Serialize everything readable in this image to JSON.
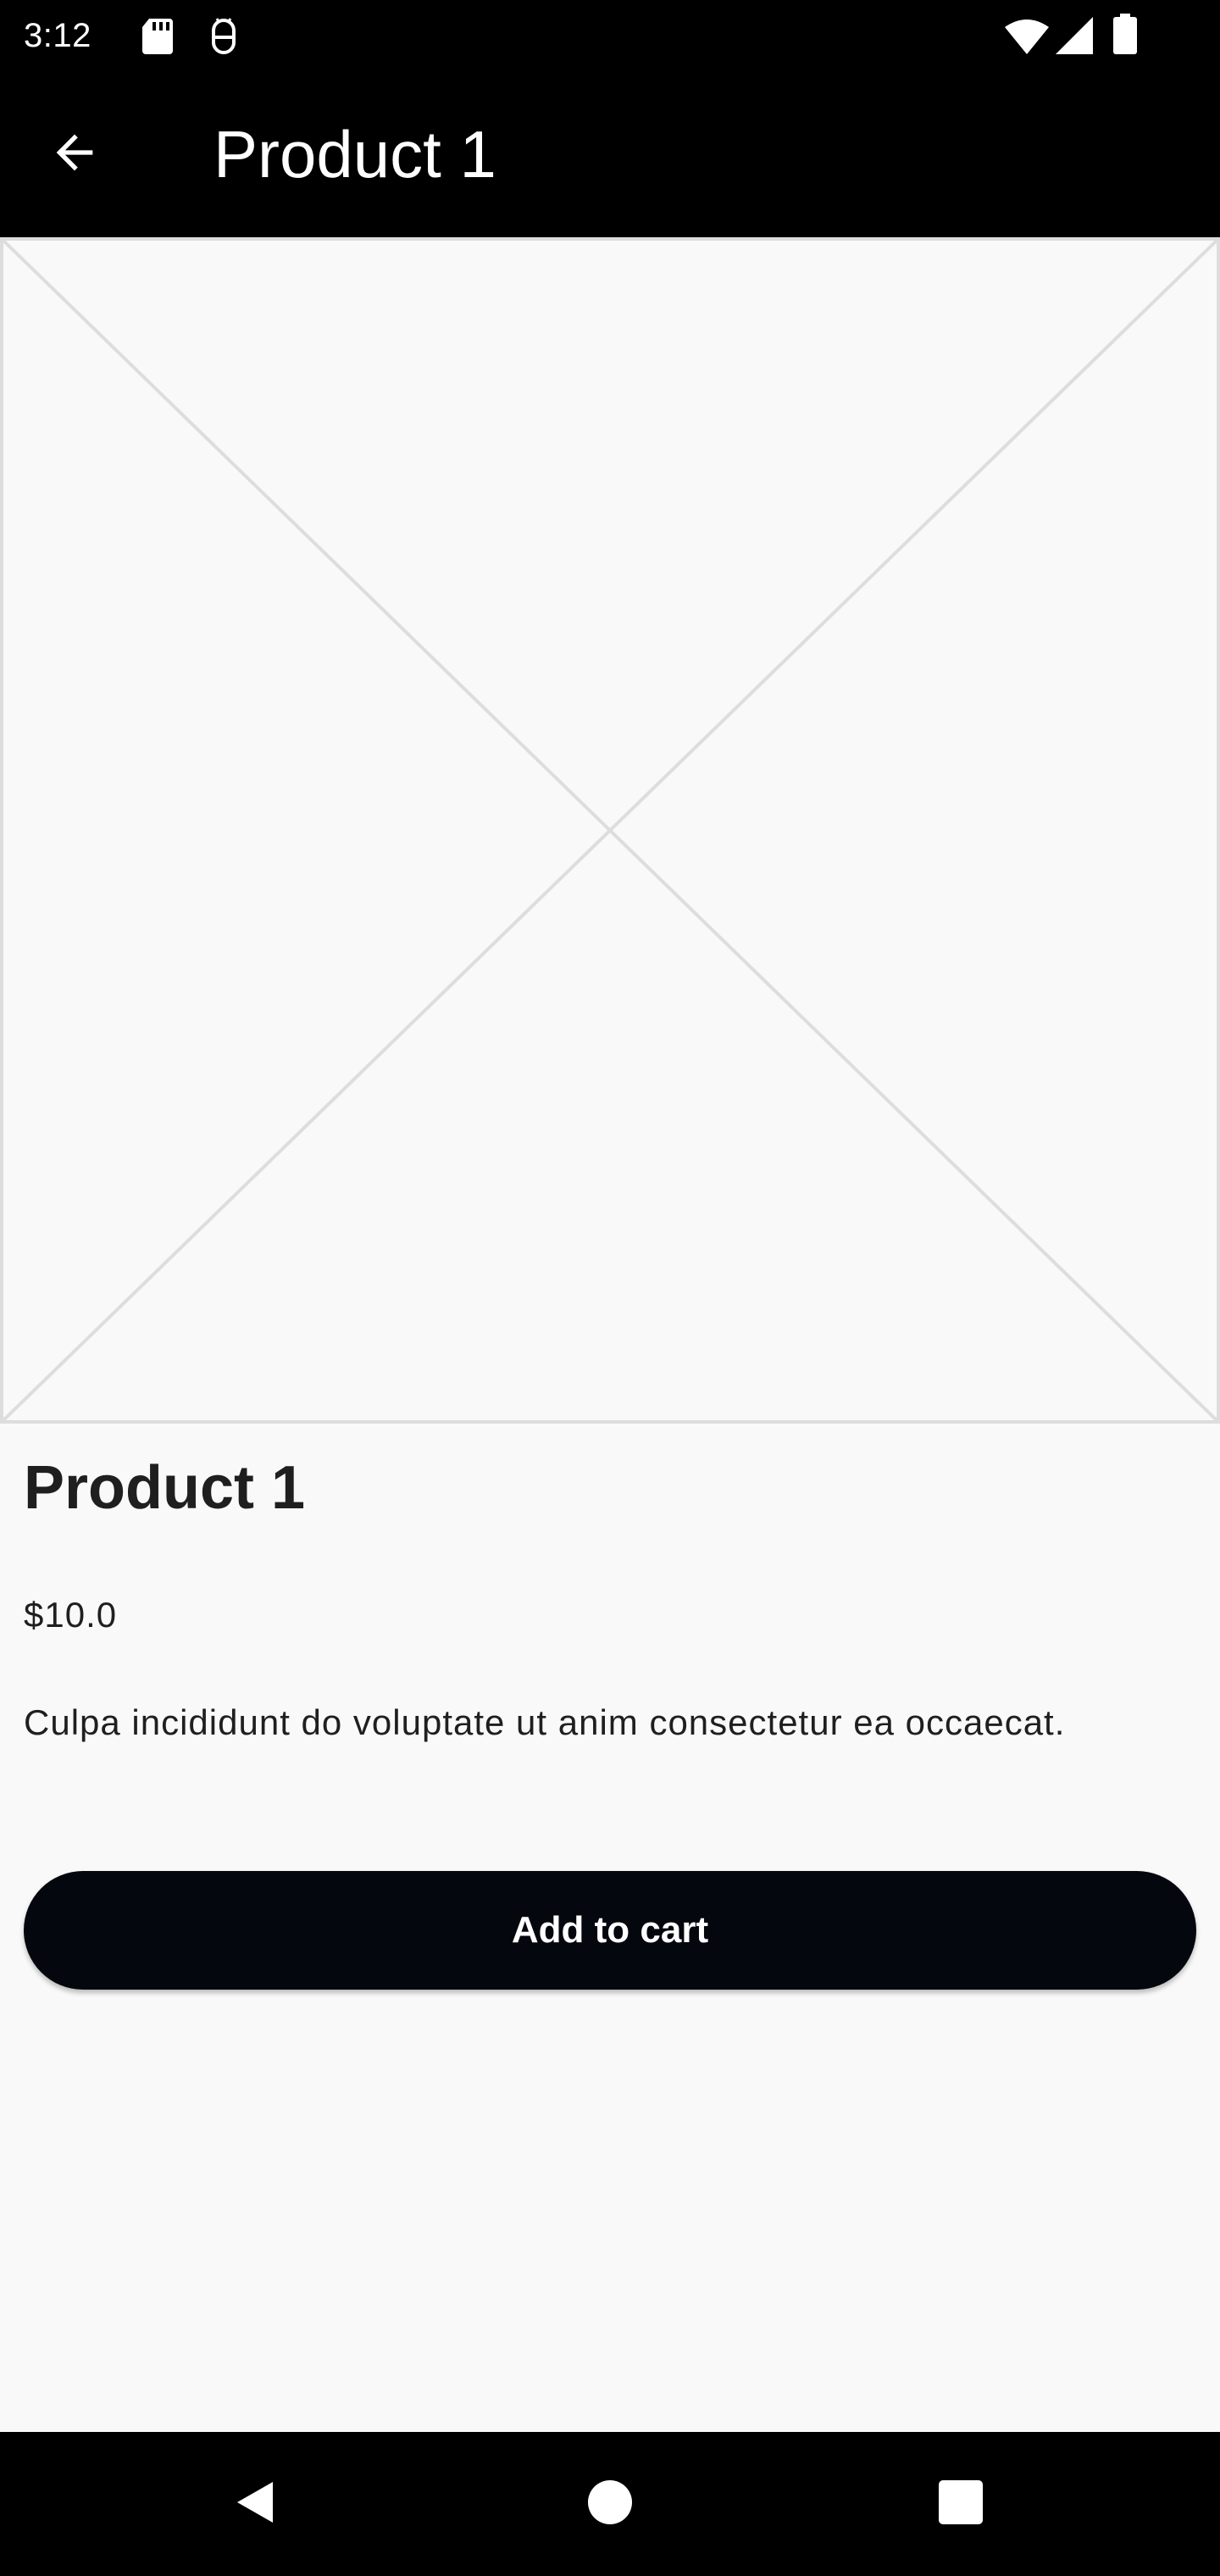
{
  "status_bar": {
    "time": "3:12",
    "icons": [
      "sd-card-icon",
      "debug-icon",
      "wifi-icon",
      "cell-signal-icon",
      "battery-icon"
    ]
  },
  "app_bar": {
    "title": "Product 1",
    "back_icon": "arrow-back-icon"
  },
  "product": {
    "image": "image-placeholder",
    "name": "Product 1",
    "price": "$10.0",
    "description": "Culpa incididunt do voluptate ut anim consectetur ea occaecat.",
    "add_to_cart_label": "Add to cart"
  },
  "nav_bar": {
    "icons": [
      "nav-back-icon",
      "nav-home-icon",
      "nav-recents-icon"
    ]
  },
  "colors": {
    "bars": "#000000",
    "background": "#f9f9f9",
    "button": "#04070d",
    "placeholder_line": "#dddddd"
  }
}
